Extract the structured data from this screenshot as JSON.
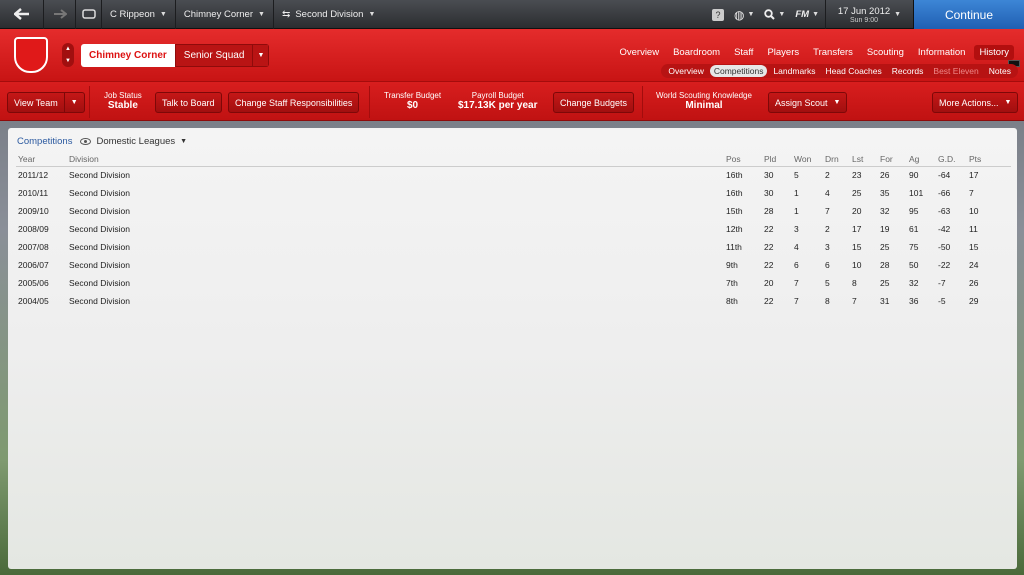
{
  "topbar": {
    "manager": "C Rippeon",
    "club": "Chimney Corner",
    "competition": "Second Division",
    "fm_label": "FM",
    "date": "17 Jun 2012",
    "day_time": "Sun 9:00",
    "continue_label": "Continue"
  },
  "header": {
    "team_name": "Chimney Corner",
    "squad": "Senior Squad",
    "nav_main": [
      "Overview",
      "Boardroom",
      "Staff",
      "Players",
      "Transfers",
      "Scouting",
      "Information",
      "History"
    ],
    "nav_sub": [
      "Overview",
      "Competitions",
      "Landmarks",
      "Head Coaches",
      "Records",
      "Best Eleven",
      "Notes"
    ]
  },
  "actions": {
    "view_team": "View Team",
    "job_status_label": "Job Status",
    "job_status_value": "Stable",
    "talk_to_board": "Talk to Board",
    "change_staff": "Change Staff Responsibilities",
    "transfer_budget_label": "Transfer Budget",
    "transfer_budget_value": "$0",
    "payroll_budget_label": "Payroll Budget",
    "payroll_budget_value": "$17.13K per year",
    "change_budgets": "Change Budgets",
    "scouting_label": "World Scouting Knowledge",
    "scouting_value": "Minimal",
    "assign_scout": "Assign Scout",
    "more_actions": "More Actions..."
  },
  "panel": {
    "title": "Competitions",
    "filter": "Domestic Leagues",
    "columns": [
      "Year",
      "Division",
      "Pos",
      "Pld",
      "Won",
      "Drn",
      "Lst",
      "For",
      "Ag",
      "G.D.",
      "Pts"
    ],
    "rows": [
      [
        "2011/12",
        "Second Division",
        "16th",
        "30",
        "5",
        "2",
        "23",
        "26",
        "90",
        "-64",
        "17"
      ],
      [
        "2010/11",
        "Second Division",
        "16th",
        "30",
        "1",
        "4",
        "25",
        "35",
        "101",
        "-66",
        "7"
      ],
      [
        "2009/10",
        "Second Division",
        "15th",
        "28",
        "1",
        "7",
        "20",
        "32",
        "95",
        "-63",
        "10"
      ],
      [
        "2008/09",
        "Second Division",
        "12th",
        "22",
        "3",
        "2",
        "17",
        "19",
        "61",
        "-42",
        "11"
      ],
      [
        "2007/08",
        "Second Division",
        "11th",
        "22",
        "4",
        "3",
        "15",
        "25",
        "75",
        "-50",
        "15"
      ],
      [
        "2006/07",
        "Second Division",
        "9th",
        "22",
        "6",
        "6",
        "10",
        "28",
        "50",
        "-22",
        "24"
      ],
      [
        "2005/06",
        "Second Division",
        "7th",
        "20",
        "7",
        "5",
        "8",
        "25",
        "32",
        "-7",
        "26"
      ],
      [
        "2004/05",
        "Second Division",
        "8th",
        "22",
        "7",
        "8",
        "7",
        "31",
        "36",
        "-5",
        "29"
      ]
    ]
  }
}
